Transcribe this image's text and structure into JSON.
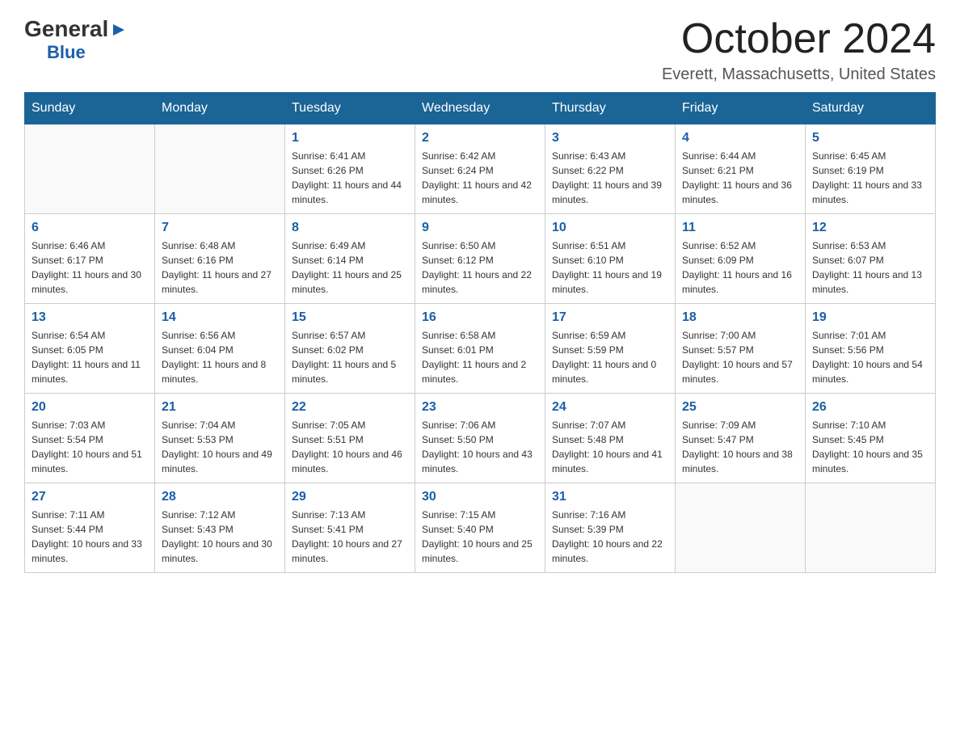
{
  "logo": {
    "general": "General",
    "blue": "Blue",
    "arrow": "▶"
  },
  "title": "October 2024",
  "location": "Everett, Massachusetts, United States",
  "headers": [
    "Sunday",
    "Monday",
    "Tuesday",
    "Wednesday",
    "Thursday",
    "Friday",
    "Saturday"
  ],
  "weeks": [
    [
      {
        "day": "",
        "sunrise": "",
        "sunset": "",
        "daylight": ""
      },
      {
        "day": "",
        "sunrise": "",
        "sunset": "",
        "daylight": ""
      },
      {
        "day": "1",
        "sunrise": "Sunrise: 6:41 AM",
        "sunset": "Sunset: 6:26 PM",
        "daylight": "Daylight: 11 hours and 44 minutes."
      },
      {
        "day": "2",
        "sunrise": "Sunrise: 6:42 AM",
        "sunset": "Sunset: 6:24 PM",
        "daylight": "Daylight: 11 hours and 42 minutes."
      },
      {
        "day": "3",
        "sunrise": "Sunrise: 6:43 AM",
        "sunset": "Sunset: 6:22 PM",
        "daylight": "Daylight: 11 hours and 39 minutes."
      },
      {
        "day": "4",
        "sunrise": "Sunrise: 6:44 AM",
        "sunset": "Sunset: 6:21 PM",
        "daylight": "Daylight: 11 hours and 36 minutes."
      },
      {
        "day": "5",
        "sunrise": "Sunrise: 6:45 AM",
        "sunset": "Sunset: 6:19 PM",
        "daylight": "Daylight: 11 hours and 33 minutes."
      }
    ],
    [
      {
        "day": "6",
        "sunrise": "Sunrise: 6:46 AM",
        "sunset": "Sunset: 6:17 PM",
        "daylight": "Daylight: 11 hours and 30 minutes."
      },
      {
        "day": "7",
        "sunrise": "Sunrise: 6:48 AM",
        "sunset": "Sunset: 6:16 PM",
        "daylight": "Daylight: 11 hours and 27 minutes."
      },
      {
        "day": "8",
        "sunrise": "Sunrise: 6:49 AM",
        "sunset": "Sunset: 6:14 PM",
        "daylight": "Daylight: 11 hours and 25 minutes."
      },
      {
        "day": "9",
        "sunrise": "Sunrise: 6:50 AM",
        "sunset": "Sunset: 6:12 PM",
        "daylight": "Daylight: 11 hours and 22 minutes."
      },
      {
        "day": "10",
        "sunrise": "Sunrise: 6:51 AM",
        "sunset": "Sunset: 6:10 PM",
        "daylight": "Daylight: 11 hours and 19 minutes."
      },
      {
        "day": "11",
        "sunrise": "Sunrise: 6:52 AM",
        "sunset": "Sunset: 6:09 PM",
        "daylight": "Daylight: 11 hours and 16 minutes."
      },
      {
        "day": "12",
        "sunrise": "Sunrise: 6:53 AM",
        "sunset": "Sunset: 6:07 PM",
        "daylight": "Daylight: 11 hours and 13 minutes."
      }
    ],
    [
      {
        "day": "13",
        "sunrise": "Sunrise: 6:54 AM",
        "sunset": "Sunset: 6:05 PM",
        "daylight": "Daylight: 11 hours and 11 minutes."
      },
      {
        "day": "14",
        "sunrise": "Sunrise: 6:56 AM",
        "sunset": "Sunset: 6:04 PM",
        "daylight": "Daylight: 11 hours and 8 minutes."
      },
      {
        "day": "15",
        "sunrise": "Sunrise: 6:57 AM",
        "sunset": "Sunset: 6:02 PM",
        "daylight": "Daylight: 11 hours and 5 minutes."
      },
      {
        "day": "16",
        "sunrise": "Sunrise: 6:58 AM",
        "sunset": "Sunset: 6:01 PM",
        "daylight": "Daylight: 11 hours and 2 minutes."
      },
      {
        "day": "17",
        "sunrise": "Sunrise: 6:59 AM",
        "sunset": "Sunset: 5:59 PM",
        "daylight": "Daylight: 11 hours and 0 minutes."
      },
      {
        "day": "18",
        "sunrise": "Sunrise: 7:00 AM",
        "sunset": "Sunset: 5:57 PM",
        "daylight": "Daylight: 10 hours and 57 minutes."
      },
      {
        "day": "19",
        "sunrise": "Sunrise: 7:01 AM",
        "sunset": "Sunset: 5:56 PM",
        "daylight": "Daylight: 10 hours and 54 minutes."
      }
    ],
    [
      {
        "day": "20",
        "sunrise": "Sunrise: 7:03 AM",
        "sunset": "Sunset: 5:54 PM",
        "daylight": "Daylight: 10 hours and 51 minutes."
      },
      {
        "day": "21",
        "sunrise": "Sunrise: 7:04 AM",
        "sunset": "Sunset: 5:53 PM",
        "daylight": "Daylight: 10 hours and 49 minutes."
      },
      {
        "day": "22",
        "sunrise": "Sunrise: 7:05 AM",
        "sunset": "Sunset: 5:51 PM",
        "daylight": "Daylight: 10 hours and 46 minutes."
      },
      {
        "day": "23",
        "sunrise": "Sunrise: 7:06 AM",
        "sunset": "Sunset: 5:50 PM",
        "daylight": "Daylight: 10 hours and 43 minutes."
      },
      {
        "day": "24",
        "sunrise": "Sunrise: 7:07 AM",
        "sunset": "Sunset: 5:48 PM",
        "daylight": "Daylight: 10 hours and 41 minutes."
      },
      {
        "day": "25",
        "sunrise": "Sunrise: 7:09 AM",
        "sunset": "Sunset: 5:47 PM",
        "daylight": "Daylight: 10 hours and 38 minutes."
      },
      {
        "day": "26",
        "sunrise": "Sunrise: 7:10 AM",
        "sunset": "Sunset: 5:45 PM",
        "daylight": "Daylight: 10 hours and 35 minutes."
      }
    ],
    [
      {
        "day": "27",
        "sunrise": "Sunrise: 7:11 AM",
        "sunset": "Sunset: 5:44 PM",
        "daylight": "Daylight: 10 hours and 33 minutes."
      },
      {
        "day": "28",
        "sunrise": "Sunrise: 7:12 AM",
        "sunset": "Sunset: 5:43 PM",
        "daylight": "Daylight: 10 hours and 30 minutes."
      },
      {
        "day": "29",
        "sunrise": "Sunrise: 7:13 AM",
        "sunset": "Sunset: 5:41 PM",
        "daylight": "Daylight: 10 hours and 27 minutes."
      },
      {
        "day": "30",
        "sunrise": "Sunrise: 7:15 AM",
        "sunset": "Sunset: 5:40 PM",
        "daylight": "Daylight: 10 hours and 25 minutes."
      },
      {
        "day": "31",
        "sunrise": "Sunrise: 7:16 AM",
        "sunset": "Sunset: 5:39 PM",
        "daylight": "Daylight: 10 hours and 22 minutes."
      },
      {
        "day": "",
        "sunrise": "",
        "sunset": "",
        "daylight": ""
      },
      {
        "day": "",
        "sunrise": "",
        "sunset": "",
        "daylight": ""
      }
    ]
  ]
}
